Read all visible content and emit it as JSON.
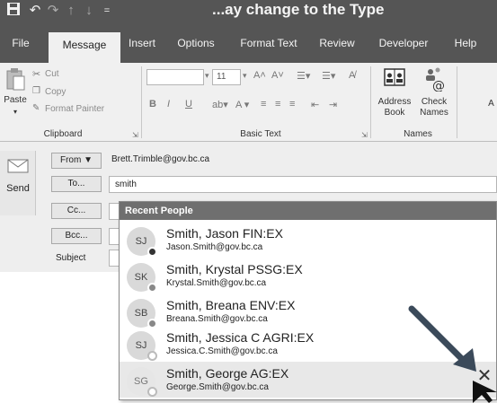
{
  "window": {
    "caption": "...ay change to the Type"
  },
  "quick_access": [
    {
      "icon": "save-icon",
      "glyph": "💾"
    },
    {
      "icon": "undo-icon",
      "glyph": "↶"
    },
    {
      "icon": "redo-icon",
      "glyph": "↷"
    },
    {
      "icon": "up-icon",
      "glyph": "↑"
    },
    {
      "icon": "down-icon",
      "glyph": "↓"
    },
    {
      "icon": "customize-icon",
      "glyph": "="
    }
  ],
  "tabs": [
    "File",
    "Message",
    "Insert",
    "Options",
    "Format Text",
    "Review",
    "Developer",
    "Help"
  ],
  "ribbon": {
    "clipboard": {
      "paste": "Paste",
      "cut": "Cut",
      "copy": "Copy",
      "format_painter": "Format Painter",
      "label": "Clipboard"
    },
    "basic_text": {
      "font_size": "11",
      "label": "Basic Text"
    },
    "names": {
      "address_book": "Address Book",
      "check_names": "Check Names",
      "label": "Names"
    }
  },
  "compose": {
    "send": "Send",
    "from_button": "From ▼",
    "from_value": "Brett.Trimble@gov.bc.ca",
    "to_button": "To...",
    "to_value": "smith",
    "cc_button": "Cc...",
    "bcc_button": "Bcc...",
    "subject_label": "Subject"
  },
  "autocomplete": {
    "header": "Recent People",
    "people": [
      {
        "initials": "SJ",
        "name": "Smith, Jason FIN:EX",
        "email": "Jason.Smith@gov.bc.ca",
        "presence_color": "#333333"
      },
      {
        "initials": "SK",
        "name": "Smith, Krystal PSSG:EX",
        "email": "Krystal.Smith@gov.bc.ca",
        "presence_color": "#888888"
      },
      {
        "initials": "SB",
        "name": "Smith, Breana ENV:EX",
        "email": "Breana.Smith@gov.bc.ca",
        "presence_color": "#888888"
      },
      {
        "initials": "SJ",
        "name": "Smith, Jessica C AGRI:EX",
        "email": "Jessica.C.Smith@gov.bc.ca",
        "presence_color": "#ffffff"
      },
      {
        "initials": "SG",
        "name": "Smith, George AG:EX",
        "email": "George.Smith@gov.bc.ca",
        "presence_color": "#ffffff"
      }
    ],
    "remove_glyph": "✕"
  }
}
